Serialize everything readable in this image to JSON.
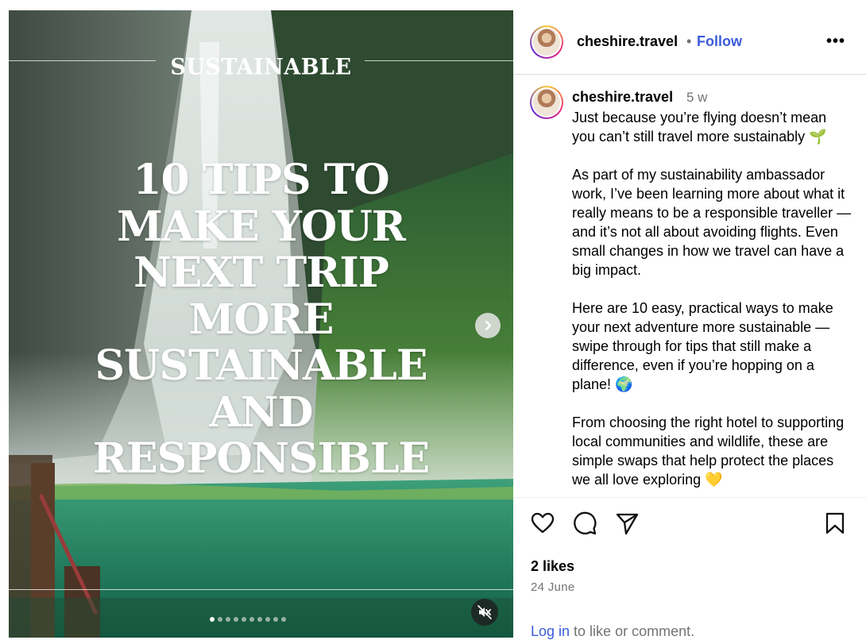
{
  "media": {
    "kicker": "SUSTAINABLE",
    "headline": "10 TIPS TO\nMAKE YOUR\nNEXT TRIP\nMORE\nSUSTAINABLE\nAND\nRESPONSIBLE",
    "next_icon": "chevron-right-icon",
    "mute_icon": "speaker-muted-icon",
    "carousel": {
      "count": 10,
      "active": 1
    }
  },
  "header": {
    "username": "cheshire.travel",
    "separator": "•",
    "follow": "Follow",
    "more": "•••"
  },
  "caption": {
    "username": "cheshire.travel",
    "time": "5 w",
    "paragraphs": [
      "Just because you’re flying doesn’t mean you can’t still travel more sustainably 🌱",
      "As part of my sustainability ambassador work, I’ve been learning more about what it really means to be a responsible traveller — and it’s not all about avoiding flights. Even small changes in how we travel can have a big impact.",
      "Here are 10 easy, practical ways to make your next adventure more sustainable — swipe through for tips that still make a difference, even if you’re hopping on a plane! 🌍",
      "From choosing the right hotel to supporting local communities and wildlife, these are simple swaps that help protect the places we all love exploring 💛"
    ]
  },
  "actions": {
    "like_icon": "heart-icon",
    "comment_icon": "comment-icon",
    "share_icon": "send-icon",
    "save_icon": "bookmark-icon",
    "likes": "2 likes",
    "date": "24 June",
    "login_link": "Log in",
    "login_rest": " to like or comment."
  },
  "colors": {
    "link": "#3b5bdb",
    "muted": "#737373"
  }
}
